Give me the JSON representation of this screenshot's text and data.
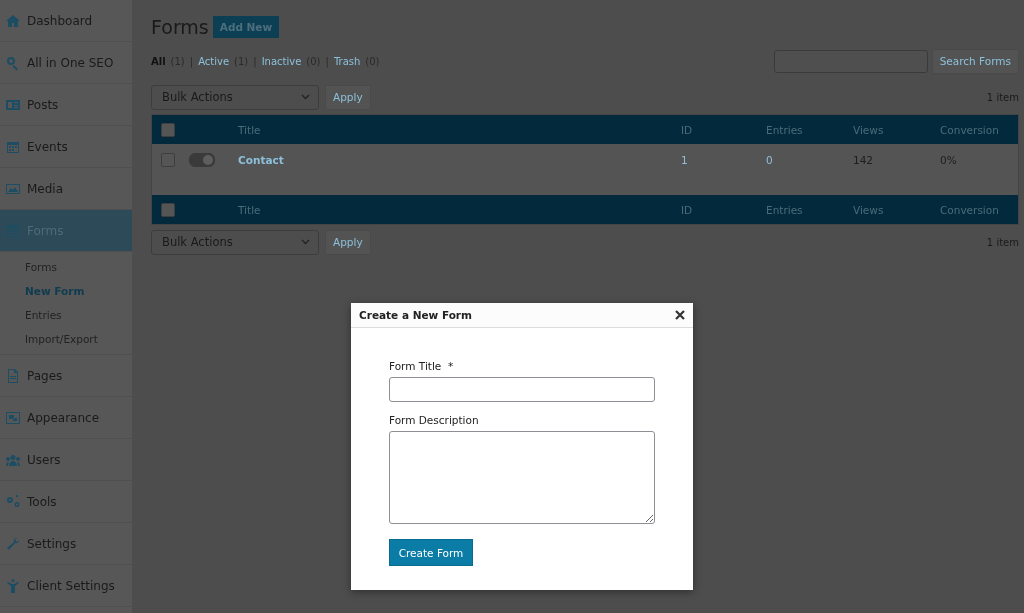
{
  "sidebar": {
    "items": [
      {
        "label": "Dashboard",
        "selected": false
      },
      {
        "label": "All in One SEO",
        "selected": false
      },
      {
        "label": "Posts",
        "selected": false
      },
      {
        "label": "Events",
        "selected": false
      },
      {
        "label": "Media",
        "selected": false
      },
      {
        "label": "Forms",
        "selected": true,
        "children": [
          {
            "label": "Forms",
            "selected": false
          },
          {
            "label": "New Form",
            "selected": true
          },
          {
            "label": "Entries",
            "selected": false
          },
          {
            "label": "Import/Export",
            "selected": false
          }
        ]
      },
      {
        "label": "Pages",
        "selected": false
      },
      {
        "label": "Appearance",
        "selected": false
      },
      {
        "label": "Users",
        "selected": false
      },
      {
        "label": "Tools",
        "selected": false
      },
      {
        "label": "Settings",
        "selected": false
      },
      {
        "label": "Client Settings",
        "selected": false
      }
    ]
  },
  "page": {
    "title": "Forms",
    "add_button": "Add New",
    "filters": [
      {
        "label": "All",
        "count": "(1)",
        "selected": true
      },
      {
        "separator": "|",
        "label": "Active",
        "count": "(1)",
        "selected": false
      },
      {
        "separator": "|",
        "label": "Inactive",
        "count": "(0)",
        "selected": false
      },
      {
        "separator": "|",
        "label": "Trash",
        "count": "(0)",
        "selected": false
      }
    ],
    "search_button": "Search Forms",
    "bulk_top": {
      "select": "Bulk Actions",
      "apply": "Apply",
      "count": "1 item"
    },
    "bulk_bottom": {
      "select": "Bulk Actions",
      "apply": "Apply",
      "count": "1 item"
    }
  },
  "table": {
    "header_checked": false,
    "columns": [
      "Title",
      "ID",
      "Entries",
      "Views",
      "Conversion"
    ],
    "footer_checked": false,
    "footer_columns": [
      "Title",
      "ID",
      "Entries",
      "Views",
      "Conversion"
    ],
    "rows": [
      {
        "checked": false,
        "on": true,
        "title": "Contact",
        "id": "1",
        "entries": "0",
        "views": "142",
        "conversion": "0%"
      }
    ]
  },
  "dialog": {
    "title": "Create a New Form",
    "title_label": "Form Title",
    "required_mark": "*",
    "description_label": "Form Description",
    "submit": "Create Form"
  }
}
